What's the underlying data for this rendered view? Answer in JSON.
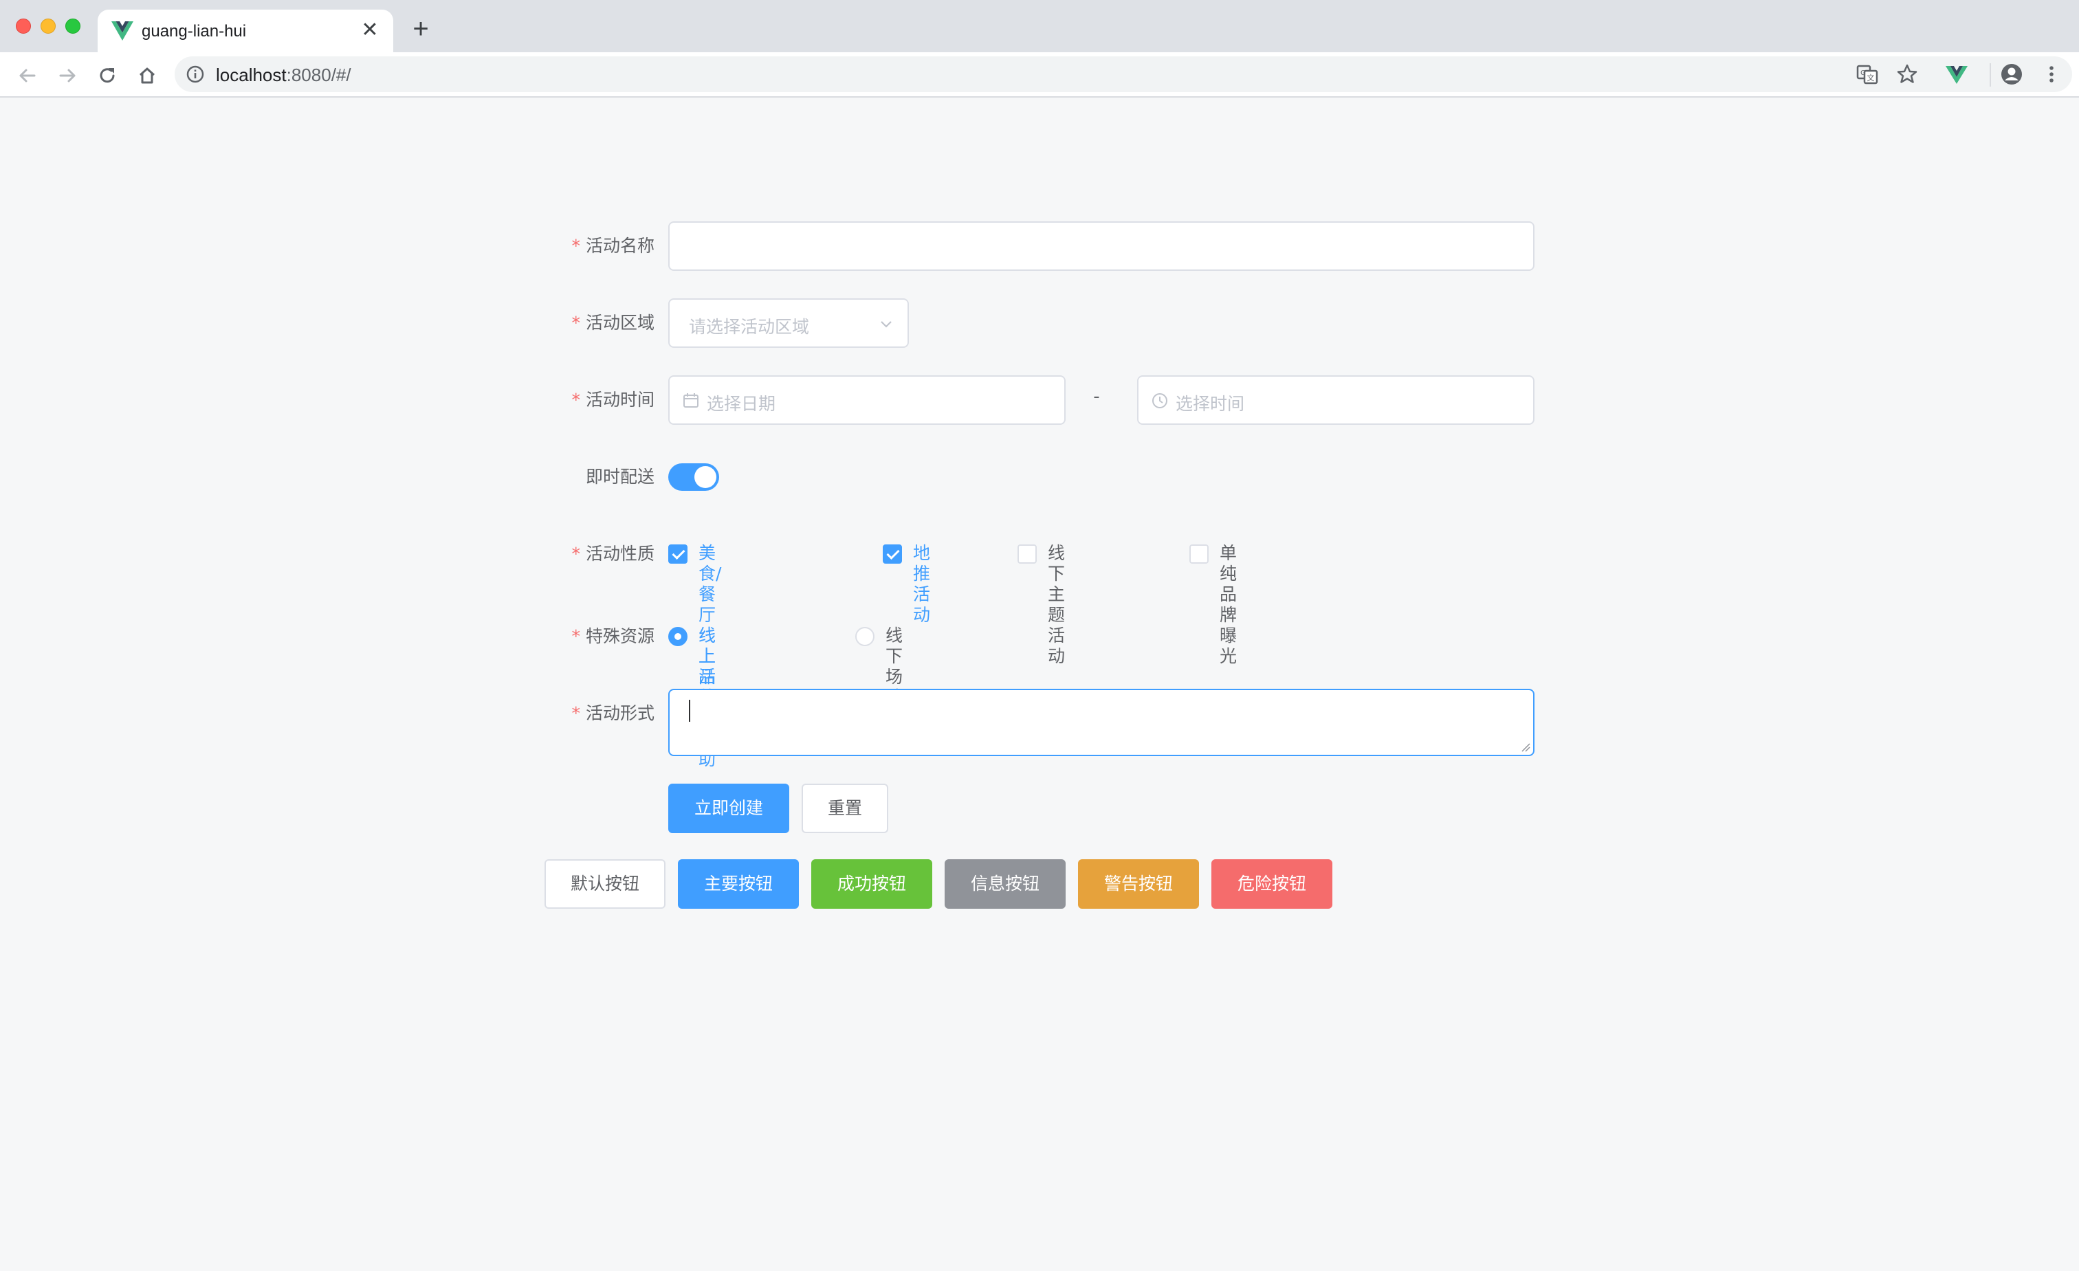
{
  "browser": {
    "tab_title": "guang-lian-hui",
    "url_host": "localhost",
    "url_path": ":8080/#/",
    "new_tab": "+",
    "close": "✕"
  },
  "form": {
    "required_mark": "*",
    "activity_name": {
      "label": "活动名称",
      "value": ""
    },
    "region": {
      "label": "活动区域",
      "placeholder": "请选择活动区域"
    },
    "time": {
      "label": "活动时间",
      "date_placeholder": "选择日期",
      "separator": "-",
      "time_placeholder": "选择时间"
    },
    "delivery": {
      "label": "即时配送",
      "on": true
    },
    "type": {
      "label": "活动性质",
      "options": [
        {
          "label": "美食/餐厅线上活动",
          "checked": true
        },
        {
          "label": "地推活动",
          "checked": true
        },
        {
          "label": "线下主题活动",
          "checked": false
        },
        {
          "label": "单纯品牌曝光",
          "checked": false
        }
      ]
    },
    "resource": {
      "label": "特殊资源",
      "options": [
        {
          "label": "线上品牌商赞助",
          "checked": true
        },
        {
          "label": "线下场地免费",
          "checked": false
        }
      ]
    },
    "desc": {
      "label": "活动形式",
      "value": ""
    },
    "submit_label": "立即创建",
    "reset_label": "重置"
  },
  "buttons": {
    "default": "默认按钮",
    "primary": "主要按钮",
    "success": "成功按钮",
    "info": "信息按钮",
    "warning": "警告按钮",
    "danger": "危险按钮"
  },
  "colors": {
    "primary": "#409eff",
    "success": "#67c23a",
    "info": "#909399",
    "warning": "#e6a23c",
    "danger": "#f56c6c"
  }
}
